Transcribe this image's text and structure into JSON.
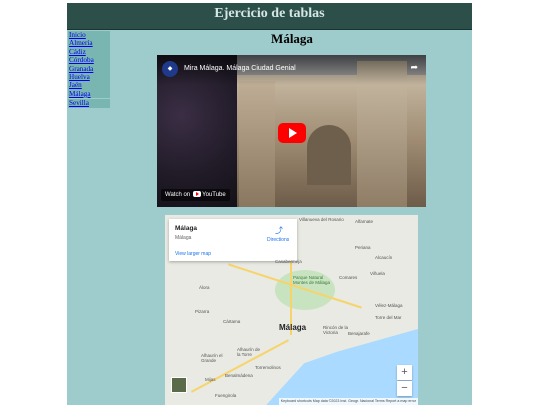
{
  "header": {
    "title": "Ejercicio de tablas"
  },
  "sidebar": {
    "items": [
      {
        "label": "Inicio"
      },
      {
        "label": "Almería"
      },
      {
        "label": "Cádiz"
      },
      {
        "label": "Córdoba"
      },
      {
        "label": "Granada"
      },
      {
        "label": "Huelva"
      },
      {
        "label": "Jaén"
      },
      {
        "label": "Málaga"
      },
      {
        "label": "Sevilla"
      }
    ]
  },
  "main": {
    "title": "Málaga"
  },
  "video": {
    "title": "Mira Málaga. Málaga Ciudad Genial",
    "watch_on": "Watch on",
    "brand": "YouTube"
  },
  "map": {
    "place": "Málaga",
    "place_sub": "Málaga",
    "directions": "Directions",
    "larger": "View larger map",
    "city": "Málaga",
    "labels": {
      "l1": "Villanueva del Rosario",
      "l2": "Alfarnate",
      "l3": "Periana",
      "l4": "Alcaucín",
      "l5": "Casabermeja",
      "l6": "Comares",
      "l7": "Parque Natural Montes de Málaga",
      "l8": "Viñuela",
      "l9": "Álora",
      "l10": "Pizarra",
      "l11": "Vélez-Málaga",
      "l12": "Torre del Mar",
      "l13": "Rincón de la Victoria",
      "l14": "Benajarafe",
      "l15": "Cártama",
      "l16": "Alhaurín el Grande",
      "l17": "Alhaurín de la Torre",
      "l18": "Mijas",
      "l19": "Benalmádena",
      "l20": "Torremolinos",
      "l21": "Fuengirola"
    },
    "zoom_in": "+",
    "zoom_out": "−",
    "attribution": "Keyboard shortcuts   Map data ©2023 Inst. Geogr. Nacional   Terms   Report a map error"
  }
}
